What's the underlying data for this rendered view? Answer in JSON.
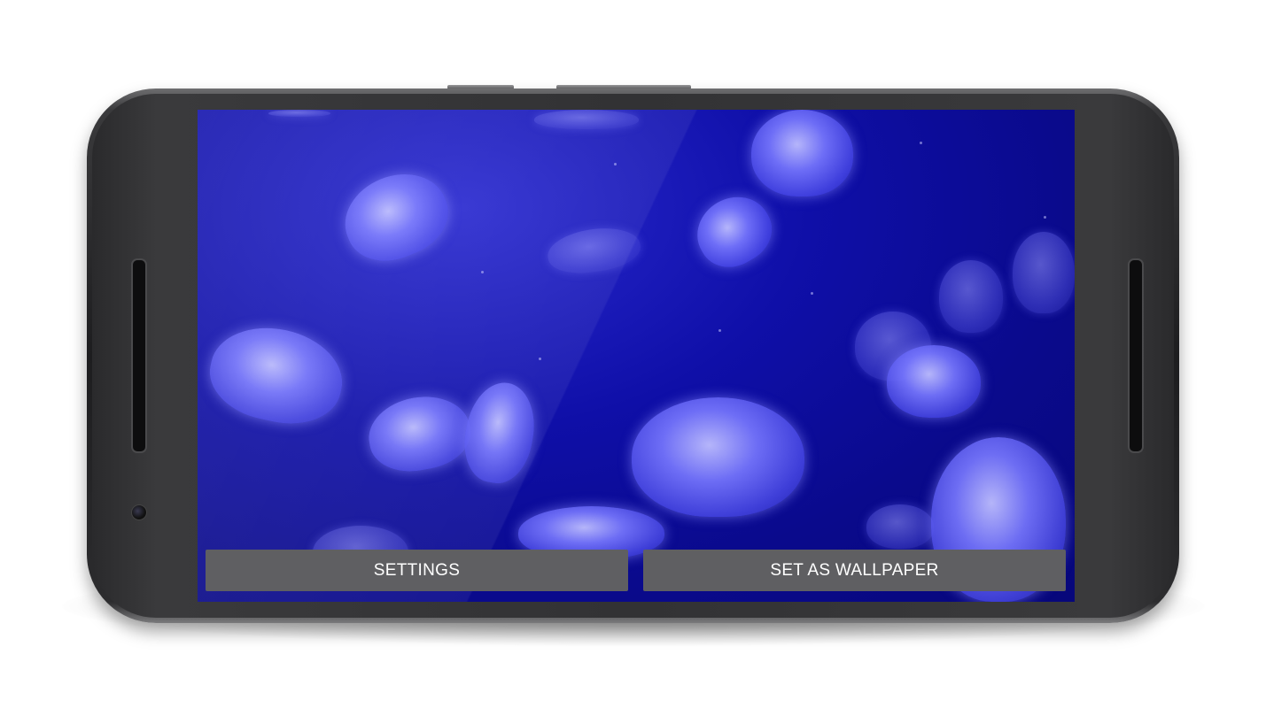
{
  "buttons": {
    "settings_label": "SETTINGS",
    "set_wallpaper_label": "SET AS WALLPAPER"
  },
  "colors": {
    "screen_background": "#0a0a8c",
    "button_background": "#5f5f62",
    "button_text": "#ffffff",
    "phone_body": "#1d1d1f"
  },
  "icons": [
    "camera-icon",
    "speaker-grille"
  ]
}
